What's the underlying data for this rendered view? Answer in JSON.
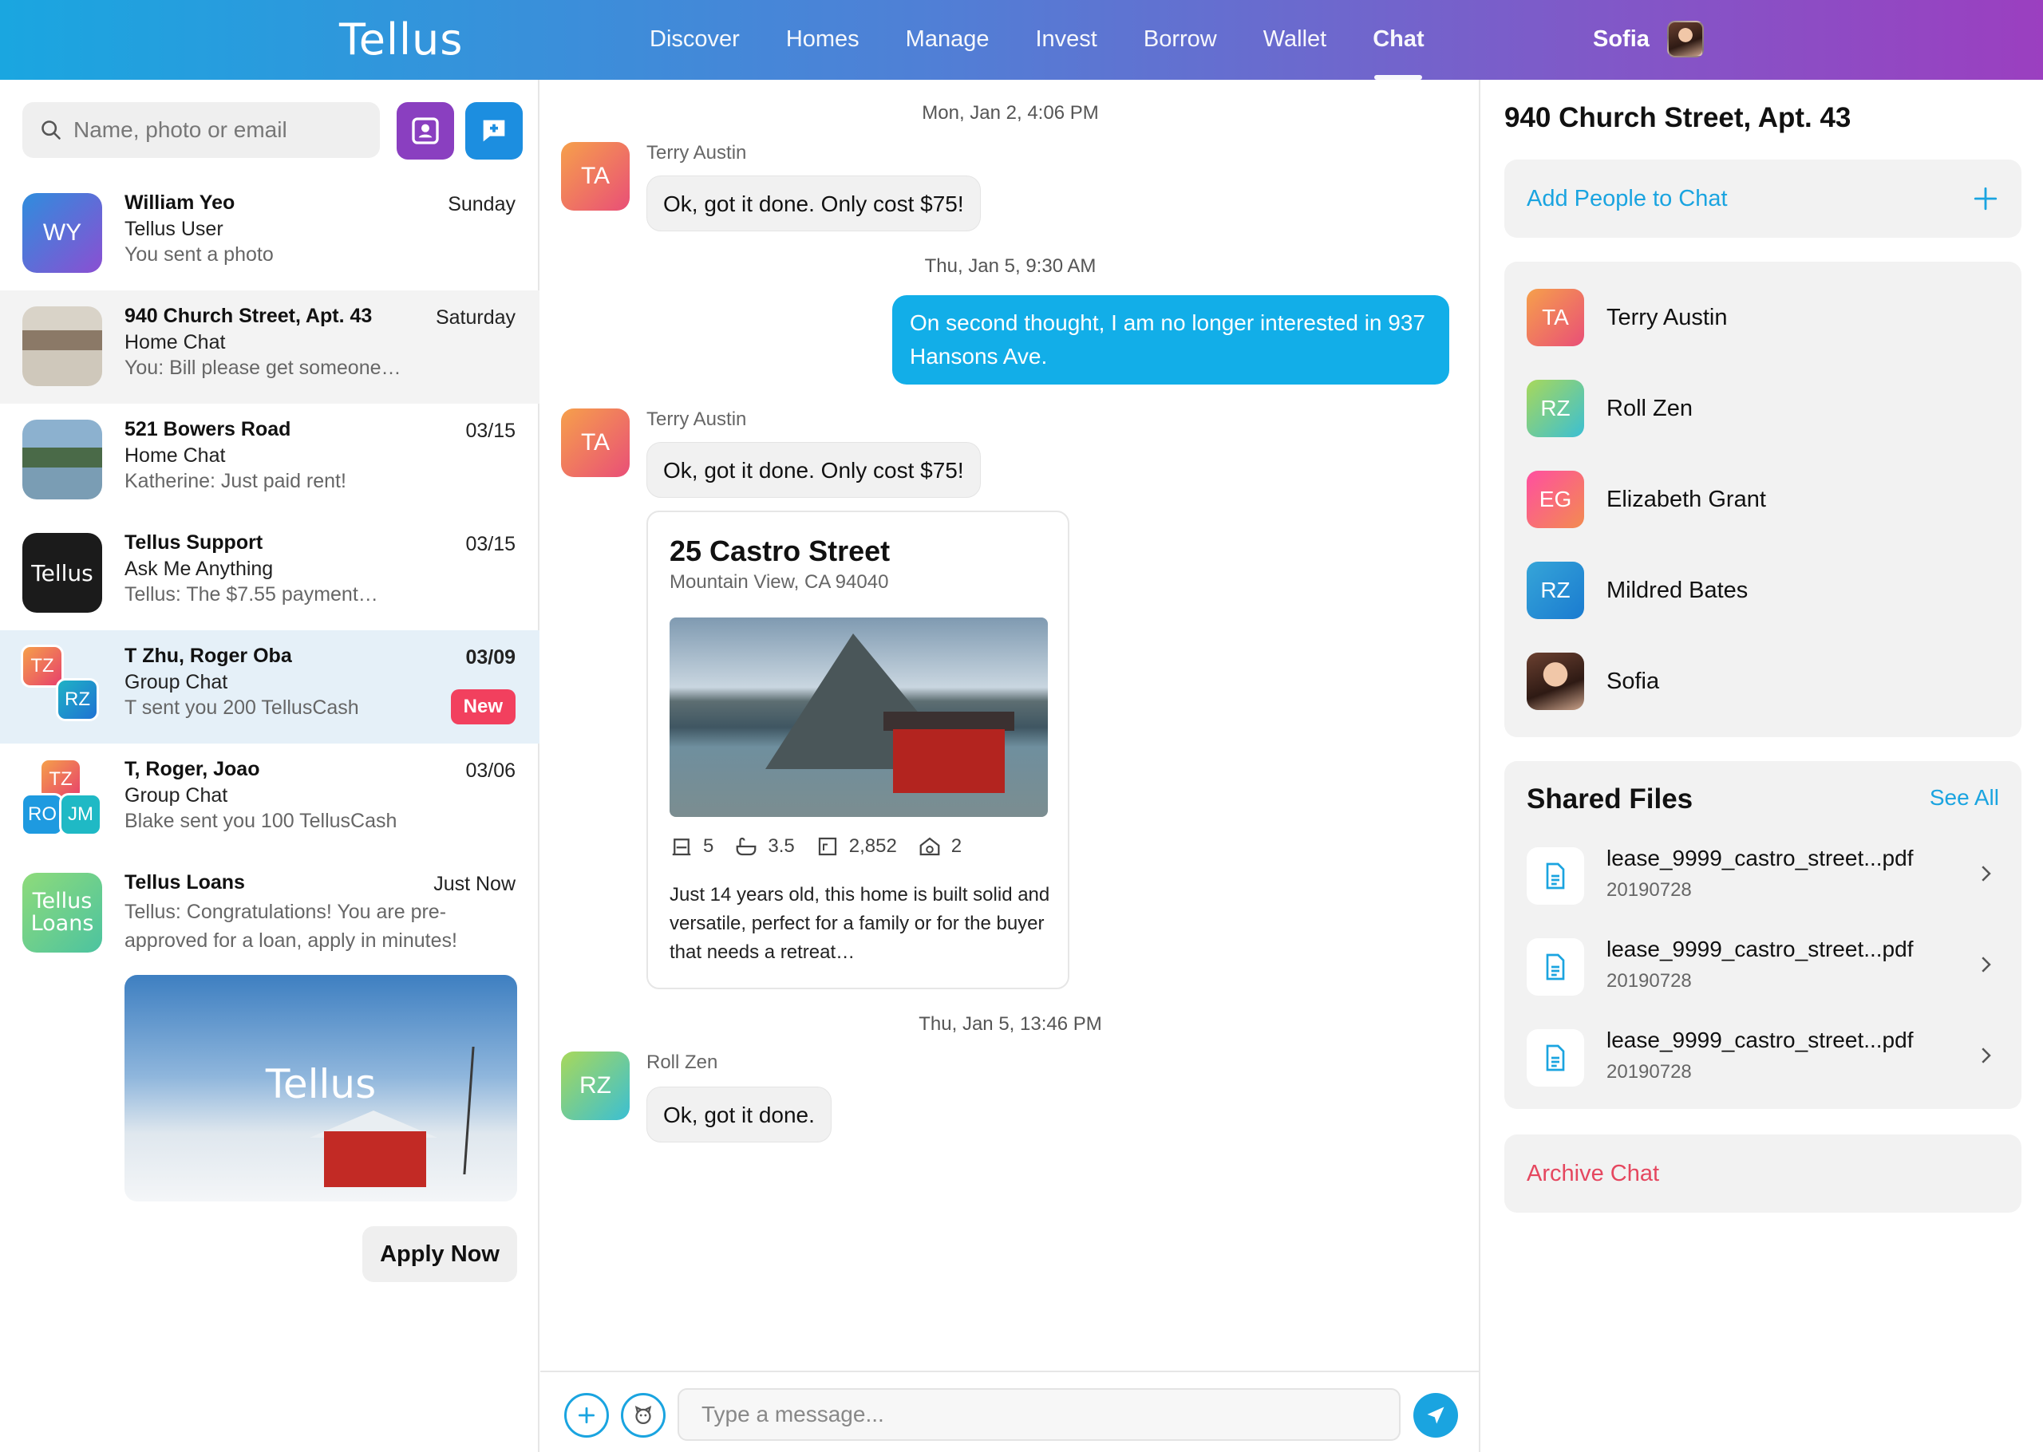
{
  "app": {
    "logo": "Tellus"
  },
  "nav": {
    "items": [
      "Discover",
      "Homes",
      "Manage",
      "Invest",
      "Borrow",
      "Wallet",
      "Chat"
    ],
    "active": "Chat"
  },
  "user": {
    "name": "Sofia"
  },
  "search": {
    "placeholder": "Name, photo or email"
  },
  "conversations": [
    {
      "title": "William Yeo",
      "subtitle": "Tellus User",
      "message": "You sent a photo",
      "date": "Sunday",
      "avatar": "WY"
    },
    {
      "title": "940 Church Street, Apt. 43",
      "subtitle": "Home Chat",
      "message": "You: Bill please get someone…",
      "date": "Saturday"
    },
    {
      "title": "521 Bowers Road",
      "subtitle": "Home Chat",
      "message": "Katherine: Just paid rent!",
      "date": "03/15"
    },
    {
      "title": "Tellus Support",
      "subtitle": "Ask Me Anything",
      "message": "Tellus: The $7.55 payment…",
      "date": "03/15",
      "avatar": "Tellus"
    },
    {
      "title": "T Zhu, Roger Oba",
      "subtitle": "Group Chat",
      "message": "T sent you 200 TellusCash",
      "date": "03/09",
      "badge": "New",
      "avatars": [
        "TZ",
        "RZ"
      ]
    },
    {
      "title": "T, Roger, Joao",
      "subtitle": "Group Chat",
      "message": "Blake sent you 100 TellusCash",
      "date": "03/06",
      "avatars": [
        "TZ",
        "RO",
        "JM"
      ]
    },
    {
      "title": "Tellus Loans",
      "message": "Tellus: Congratulations! You are pre-approved for a loan, apply in minutes!",
      "date": "Just Now",
      "avatar_top": "Tellus",
      "avatar_bottom": "Loans",
      "image_logo": "Tellus",
      "button": "Apply Now"
    }
  ],
  "chat": {
    "timestamps": [
      "Mon, Jan 2, 4:06 PM",
      "Thu, Jan 5, 9:30 AM",
      "Thu, Jan 5, 13:46 PM"
    ],
    "messages": [
      {
        "sender": "Terry Austin",
        "initials": "TA",
        "text": "Ok, got it done. Only cost $75!"
      },
      {
        "sender": "me",
        "text": "On second thought, I am no longer interested in 937 Hansons Ave."
      },
      {
        "sender": "Terry Austin",
        "initials": "TA",
        "text": "Ok, got it done. Only cost $75!"
      },
      {
        "sender": "Roll Zen",
        "initials": "RZ",
        "text": "Ok, got it done."
      }
    ],
    "listing": {
      "title": "25 Castro Street",
      "address": "Mountain View, CA 94040",
      "beds": "5",
      "baths": "3.5",
      "sqft": "2,852",
      "garage": "2",
      "description": "Just 14 years old, this home is built solid and versatile, perfect for a family or for the buyer that needs a retreat…"
    },
    "composer_placeholder": "Type a message..."
  },
  "details": {
    "title": "940 Church Street, Apt. 43",
    "add_people": "Add People to Chat",
    "people": [
      {
        "initials": "TA",
        "name": "Terry Austin"
      },
      {
        "initials": "RZ",
        "name": "Roll Zen"
      },
      {
        "initials": "EG",
        "name": "Elizabeth Grant"
      },
      {
        "initials": "RZ",
        "name": "Mildred Bates"
      },
      {
        "initials": "",
        "name": "Sofia"
      }
    ],
    "files_title": "Shared Files",
    "see_all": "See All",
    "files": [
      {
        "name": "lease_9999_castro_street...pdf",
        "date": "20190728"
      },
      {
        "name": "lease_9999_castro_street...pdf",
        "date": "20190728"
      },
      {
        "name": "lease_9999_castro_street...pdf",
        "date": "20190728"
      }
    ],
    "archive": "Archive Chat"
  }
}
